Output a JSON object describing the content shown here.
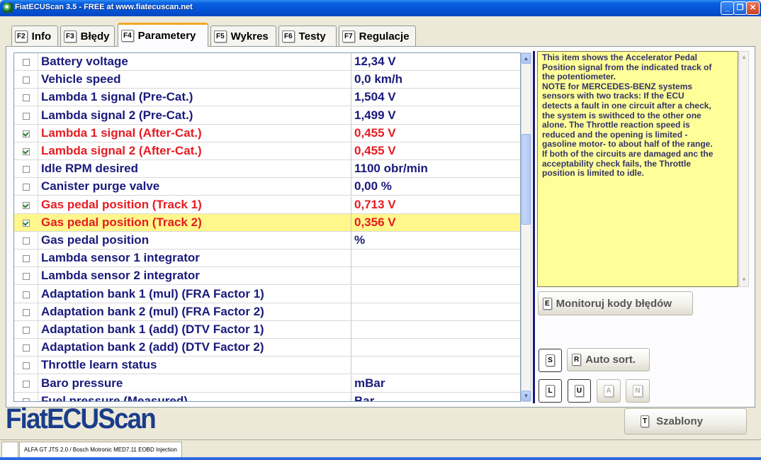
{
  "window": {
    "title": "FiatECUScan 3.5 - FREE at www.fiatecuscan.net",
    "minimize_glyph": "_",
    "maximize_glyph": "❐",
    "close_glyph": "✕"
  },
  "tabs": [
    {
      "key": "F2",
      "label": "Info",
      "active": false
    },
    {
      "key": "F3",
      "label": "Błędy",
      "active": false
    },
    {
      "key": "F4",
      "label": "Parametery",
      "active": true
    },
    {
      "key": "F5",
      "label": "Wykres",
      "active": false
    },
    {
      "key": "F6",
      "label": "Testy",
      "active": false
    },
    {
      "key": "F7",
      "label": "Regulacje",
      "active": false
    }
  ],
  "parameters": [
    {
      "name": "Battery voltage",
      "value": "12,34 V",
      "checked": false,
      "highlight": false,
      "selected": false
    },
    {
      "name": "Vehicle speed",
      "value": "0,0 km/h",
      "checked": false,
      "highlight": false,
      "selected": false
    },
    {
      "name": "Lambda 1 signal (Pre-Cat.)",
      "value": "1,504 V",
      "checked": false,
      "highlight": false,
      "selected": false
    },
    {
      "name": "Lambda signal 2 (Pre-Cat.)",
      "value": "1,499 V",
      "checked": false,
      "highlight": false,
      "selected": false
    },
    {
      "name": "Lambda 1 signal (After-Cat.)",
      "value": "0,455 V",
      "checked": true,
      "highlight": true,
      "selected": false
    },
    {
      "name": "Lambda signal 2 (After-Cat.)",
      "value": "0,455 V",
      "checked": true,
      "highlight": true,
      "selected": false
    },
    {
      "name": "Idle RPM desired",
      "value": "1100 obr/min",
      "checked": false,
      "highlight": false,
      "selected": false
    },
    {
      "name": "Canister purge valve",
      "value": "0,00 %",
      "checked": false,
      "highlight": false,
      "selected": false
    },
    {
      "name": "Gas pedal position (Track 1)",
      "value": "0,713 V",
      "checked": true,
      "highlight": true,
      "selected": false
    },
    {
      "name": "Gas pedal position (Track 2)",
      "value": "0,356 V",
      "checked": true,
      "highlight": true,
      "selected": true
    },
    {
      "name": "Gas pedal position",
      "value": " %",
      "checked": false,
      "highlight": false,
      "selected": false
    },
    {
      "name": "Lambda sensor 1 integrator",
      "value": "",
      "checked": false,
      "highlight": false,
      "selected": false
    },
    {
      "name": "Lambda sensor 2 integrator",
      "value": "",
      "checked": false,
      "highlight": false,
      "selected": false
    },
    {
      "name": "Adaptation bank 1 (mul) (FRA Factor 1)",
      "value": "",
      "checked": false,
      "highlight": false,
      "selected": false
    },
    {
      "name": "Adaptation bank 2 (mul) (FRA Factor 2)",
      "value": "",
      "checked": false,
      "highlight": false,
      "selected": false
    },
    {
      "name": "Adaptation bank 1 (add) (DTV Factor 1)",
      "value": "",
      "checked": false,
      "highlight": false,
      "selected": false
    },
    {
      "name": "Adaptation bank 2 (add) (DTV Factor 2)",
      "value": "",
      "checked": false,
      "highlight": false,
      "selected": false
    },
    {
      "name": "Throttle learn status",
      "value": "",
      "checked": false,
      "highlight": false,
      "selected": false
    },
    {
      "name": "Baro pressure",
      "value": "mBar",
      "checked": false,
      "highlight": false,
      "selected": false
    },
    {
      "name": "Fuel pressure (Measured)",
      "value": "Bar",
      "checked": false,
      "highlight": false,
      "selected": false
    }
  ],
  "scroll_glyphs": {
    "up": "▲",
    "down": "▼"
  },
  "info_text": "This item shows the Accelerator Pedal\nPosition signal from the indicated track of\nthe potentiometer.\nNOTE for MERCEDES-BENZ systems\nsensors with two tracks: If the ECU\ndetects a fault in one circuit after a check,\nthe system is swithced to the other one\nalone. The Throttle reaction speed is\nreduced and the opening is limited -\ngasoline motor- to about half of the range.\nIf both of the circuits are damaged anc the\nacceptability check fails, the Throttle\nposition is limited to idle.",
  "buttons": {
    "monitor": {
      "key": "E",
      "label": "Monitoruj kody błędów"
    },
    "s": {
      "key": "S"
    },
    "auto_sort": {
      "key": "R",
      "label": "Auto sort."
    },
    "l": {
      "key": "L"
    },
    "u": {
      "key": "U"
    },
    "a": {
      "key": "A"
    },
    "n": {
      "key": "N"
    },
    "templates": {
      "key": "T",
      "label": "Szablony"
    }
  },
  "logo_text": "FiatECUScan",
  "status_bar": {
    "ecu": "ALFA GT JTS 2.0 / Bosch Motronic MED7.11 EOBD Injection"
  },
  "colors": {
    "accent_red": "#e51c23",
    "text_navy": "#1a1a7c",
    "info_bg": "#ffff99",
    "selected_row": "#fff78c",
    "active_tab_top": "#f5a623"
  }
}
